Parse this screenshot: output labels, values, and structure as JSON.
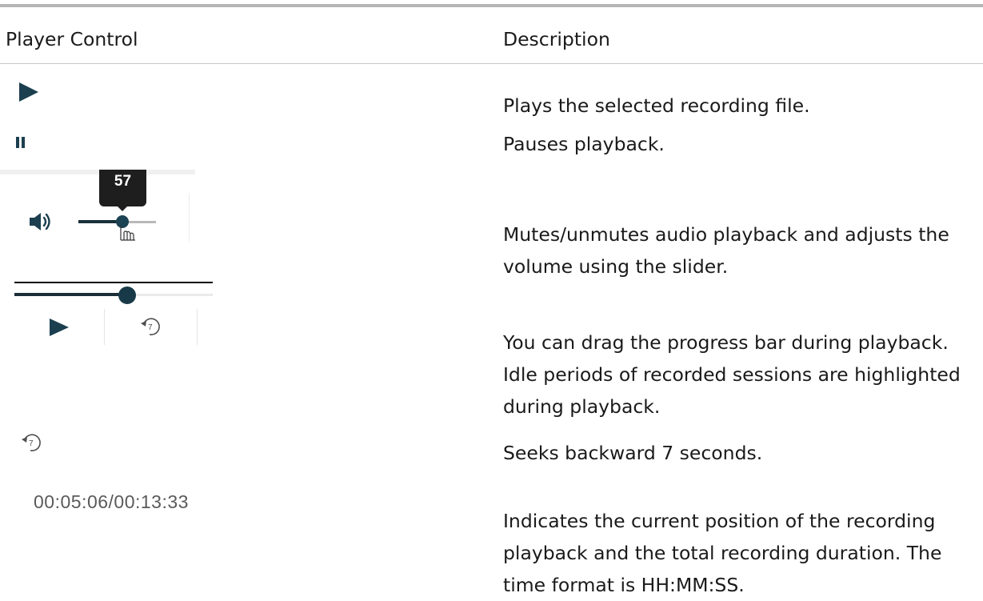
{
  "table": {
    "headers": [
      "Player Control",
      "Description"
    ],
    "rows": [
      {
        "control": "play-icon",
        "description": "Plays the selected recording file."
      },
      {
        "control": "pause-icon",
        "description": "Pauses playback."
      },
      {
        "control": "volume-slider",
        "description": "Mutes/unmutes audio playback and adjusts the volume using the slider."
      },
      {
        "control": "progress-bar",
        "description": "You can drag the progress bar during playback. Idle periods of recorded sessions are highlighted during playback."
      },
      {
        "control": "seek-back-icon",
        "description": "Seeks backward 7 seconds."
      },
      {
        "control": "timecode",
        "description": "Indicates the current position of the recording playback and the total recording duration. The time format is HH:MM:SS."
      }
    ]
  },
  "volume": {
    "tooltip": "57",
    "level_fraction": 0.57
  },
  "progress": {
    "level_fraction": 0.57
  },
  "seek_back_seconds": "7",
  "timecode": "00:05:06/00:13:33",
  "colors": {
    "icon": "#1c3f4f",
    "text": "#1a1a1a",
    "rule": "#b5b5b5",
    "tooltip_bg": "#1e1e1e"
  }
}
